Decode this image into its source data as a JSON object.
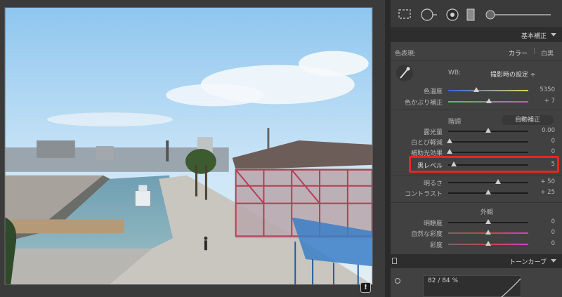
{
  "photo": {
    "alt_badge": "!"
  },
  "panel": {
    "section_title": "基本補正",
    "treatment_label": "色表現:",
    "treatment_color": "カラー",
    "treatment_separator": "|",
    "treatment_bw": "白黒",
    "wb_label": "WB:",
    "wb_value": "撮影時の設定 ÷",
    "sliders_wb": [
      {
        "label": "色温度",
        "value": "5350",
        "position": 0.45
      },
      {
        "label": "色かぶり補正",
        "value": "+ 7",
        "position": 0.52
      }
    ],
    "tone_label": "階調",
    "auto_button": "自動補正",
    "sliders_tone": [
      {
        "label": "露光量",
        "value": "0.00",
        "position": 0.5
      },
      {
        "label": "白とび軽減",
        "value": "0",
        "position": 0.0
      },
      {
        "label": "補助光効果",
        "value": "0",
        "position": 0.0
      },
      {
        "label": "黒レベル",
        "value": "5",
        "position": 0.05
      },
      {
        "label": "明るさ",
        "value": "+ 50",
        "position": 0.62
      },
      {
        "label": "コントラスト",
        "value": "+ 25",
        "position": 0.5
      }
    ],
    "presence_label": "外観",
    "sliders_presence": [
      {
        "label": "明瞭度",
        "value": "0",
        "position": 0.5
      },
      {
        "label": "自然な彩度",
        "value": "0",
        "position": 0.5
      },
      {
        "label": "彩度",
        "value": "0",
        "position": 0.5
      }
    ],
    "tone_curve_title": "トーンカーブ",
    "tone_curve_readout": "82 / 84 %"
  },
  "colors": {
    "highlight": "#e8271a",
    "temp_gradient": [
      "#3a63d6",
      "#e1d25a"
    ],
    "tint_gradient": [
      "#3fd14a",
      "#d34fd4"
    ],
    "sat_gradient": [
      "#c94545",
      "#c945c9"
    ]
  }
}
